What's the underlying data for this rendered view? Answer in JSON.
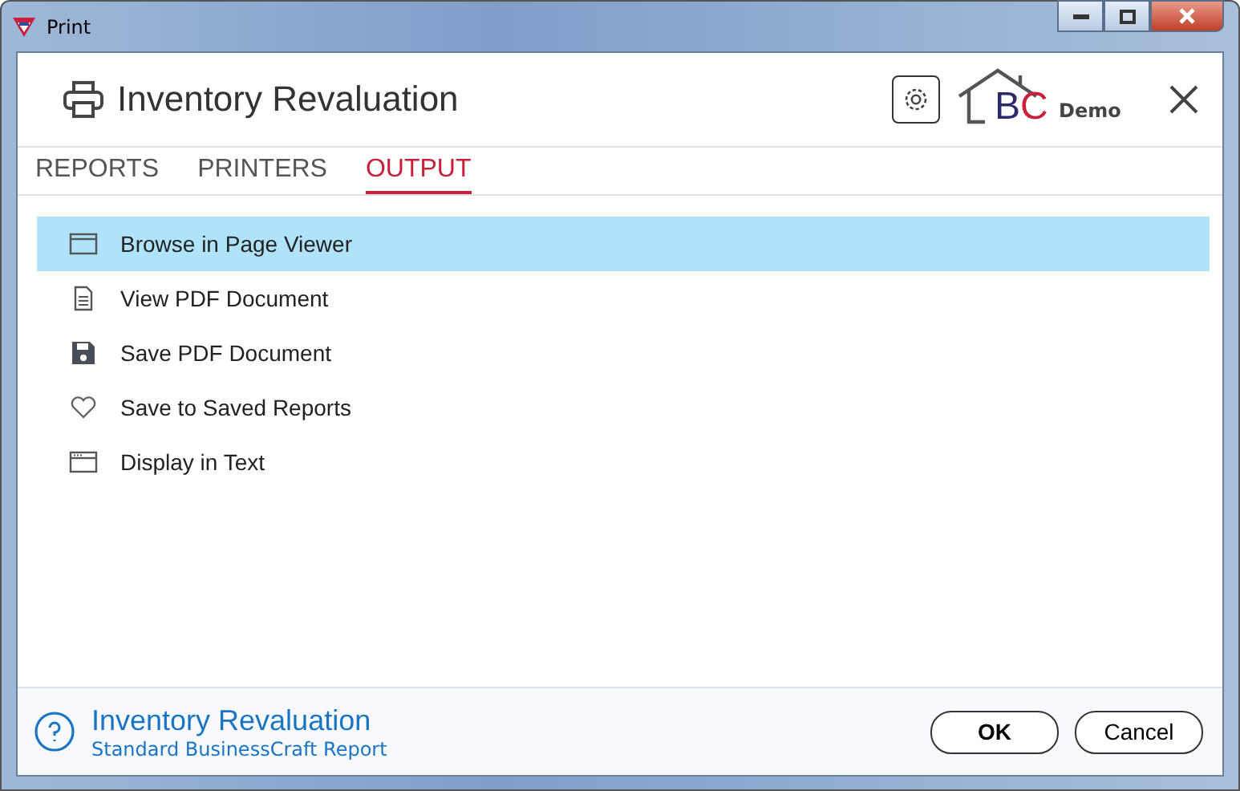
{
  "window": {
    "title": "Print"
  },
  "header": {
    "title": "Inventory Revaluation",
    "logo_letters": [
      {
        "text": "B",
        "color": "#2d2a6b"
      },
      {
        "text": "C",
        "color": "#c8203a"
      }
    ],
    "logo_caption": "Demo"
  },
  "tabs": [
    {
      "label": "REPORTS",
      "selected": false
    },
    {
      "label": "PRINTERS",
      "selected": false
    },
    {
      "label": "OUTPUT",
      "selected": true
    }
  ],
  "options": [
    {
      "label": "Browse in Page Viewer",
      "kind": "window",
      "selected": true
    },
    {
      "label": "View PDF Document",
      "kind": "document",
      "selected": false
    },
    {
      "label": "Save PDF Document",
      "kind": "save",
      "selected": false
    },
    {
      "label": "Save to Saved Reports",
      "kind": "heart",
      "selected": false
    },
    {
      "label": "Display in Text",
      "kind": "text",
      "selected": false
    }
  ],
  "footer": {
    "title": "Inventory Revaluation",
    "subtitle": "Standard BusinessCraft Report"
  },
  "buttons": [
    {
      "label": "OK",
      "kind": "primary"
    },
    {
      "label": "Cancel",
      "kind": "secondary"
    }
  ]
}
